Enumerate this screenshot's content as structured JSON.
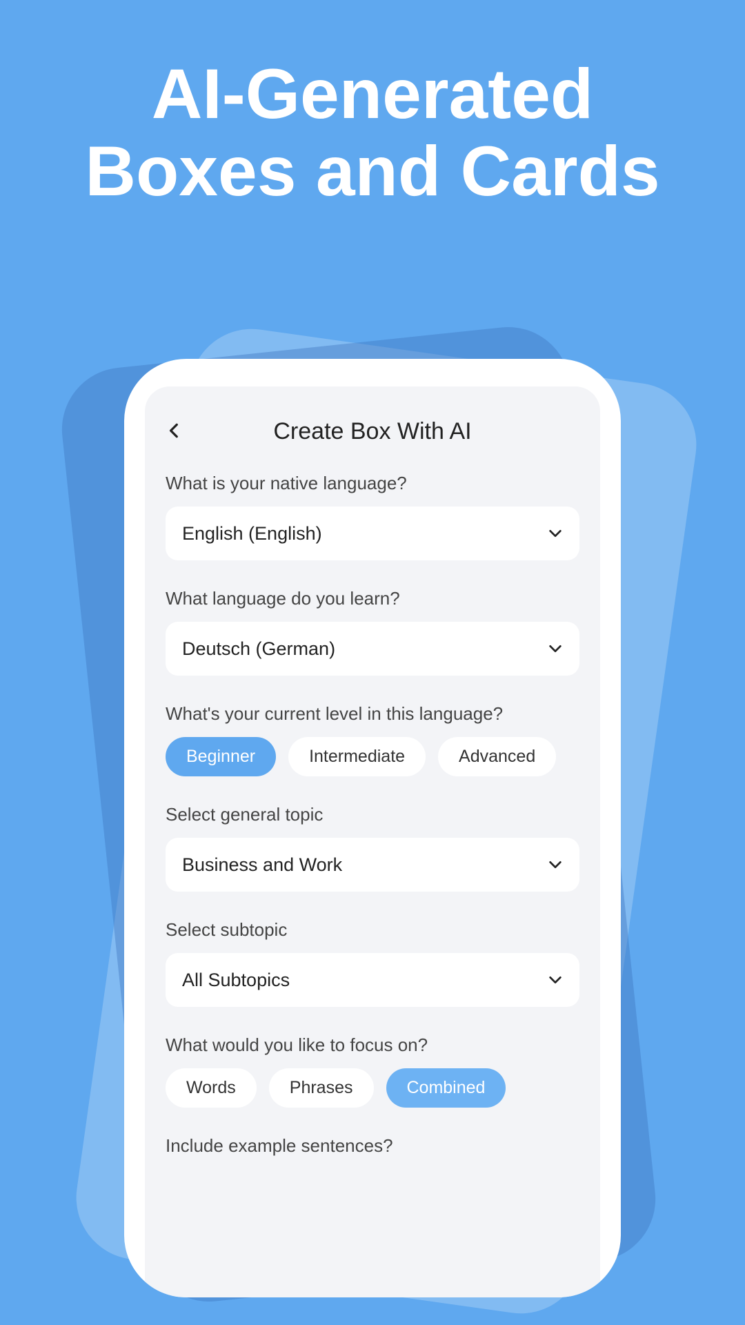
{
  "hero": {
    "line1": "AI-Generated",
    "line2": "Boxes and Cards"
  },
  "screen": {
    "title": "Create Box With AI",
    "native": {
      "label": "What is your native language?",
      "value": "English (English)"
    },
    "learn": {
      "label": "What language do you learn?",
      "value": "Deutsch (German)"
    },
    "level": {
      "label": "What's your current level in this language?",
      "options": [
        "Beginner",
        "Intermediate",
        "Advanced"
      ],
      "selected": 0
    },
    "topic": {
      "label": "Select general topic",
      "value": "Business and Work"
    },
    "subtopic": {
      "label": "Select subtopic",
      "value": "All Subtopics"
    },
    "focus": {
      "label": "What would you like to focus on?",
      "options": [
        "Words",
        "Phrases",
        "Combined"
      ],
      "selected": 2
    },
    "example": {
      "label": "Include example sentences?"
    }
  }
}
